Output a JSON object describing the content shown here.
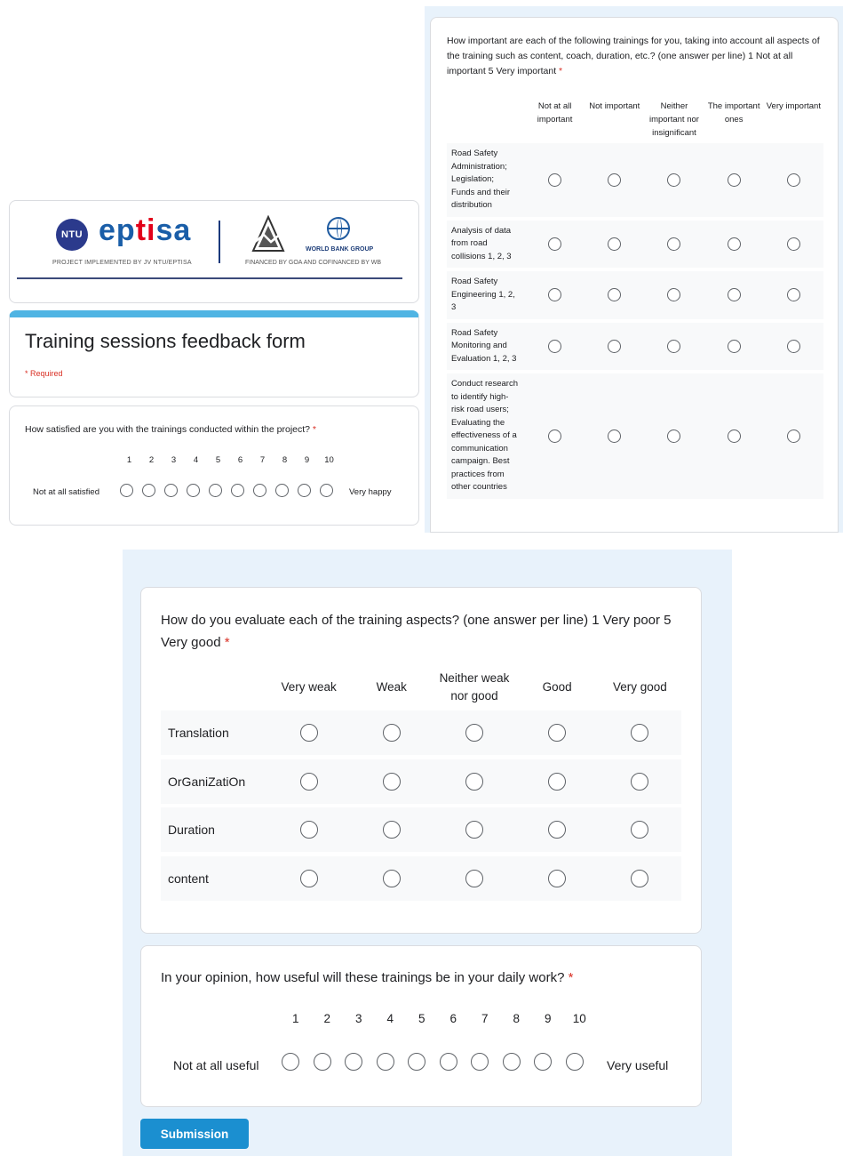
{
  "header": {
    "ntu_badge": "NTU",
    "eptisa_logo_text": "ep",
    "eptisa_logo_accent": "ti",
    "eptisa_logo_tail": "sa",
    "implemented_by": "PROJECT IMPLEMENTED BY JV NTU/EPTISA",
    "world_bank": "WORLD BANK GROUP",
    "financed_by": "FINANCED BY GOA AND COFINANCED BY WB"
  },
  "form": {
    "title": "Training sessions feedback form",
    "required_note": "* Required"
  },
  "satisfaction": {
    "question": "How satisfied are you with the trainings conducted within the project?",
    "required_mark": " *",
    "scale": [
      "1",
      "2",
      "3",
      "4",
      "5",
      "6",
      "7",
      "8",
      "9",
      "10"
    ],
    "low_label": "Not at all satisfied",
    "high_label": "Very happy"
  },
  "importance": {
    "question": "How important are each of the following trainings for you, taking into account all aspects of the training such as content, coach, duration, etc.? (one answer per line) 1 Not at all important 5 Very important",
    "required_mark": " *",
    "columns": [
      "Not at all important",
      "Not important",
      "Neither important nor insignificant",
      "The important ones",
      "Very important"
    ],
    "rows": [
      "Road Safety Administration; Legislation; Funds and their distribution",
      "Analysis of data from road collisions 1, 2, 3",
      "Road Safety Engineering 1, 2, 3",
      "Road Safety Monitoring and Evaluation 1, 2, 3",
      "Conduct research to identify high-risk road users; Evaluating the effectiveness of a communication campaign. Best practices from other countries"
    ]
  },
  "evaluation": {
    "question": "How do you evaluate each of the training aspects? (one answer per line) 1 Very poor 5 Very good",
    "required_mark": " *",
    "columns": [
      "Very weak",
      "Weak",
      "Neither weak nor good",
      "Good",
      "Very good"
    ],
    "rows": [
      "Translation",
      "OrGaniZatiOn",
      "Duration",
      "content"
    ]
  },
  "usefulness": {
    "question": "In your opinion, how useful will these trainings be in your daily work?",
    "required_mark": " *",
    "scale": [
      "1",
      "2",
      "3",
      "4",
      "5",
      "6",
      "7",
      "8",
      "9",
      "10"
    ],
    "low_label": "Not at all useful",
    "high_label": "Very useful"
  },
  "submit_label": "Submission",
  "colors": {
    "accent": "#4fb4e3",
    "button": "#1b8fd0",
    "required": "#d93025",
    "panel_background": "#e8f2fb"
  }
}
